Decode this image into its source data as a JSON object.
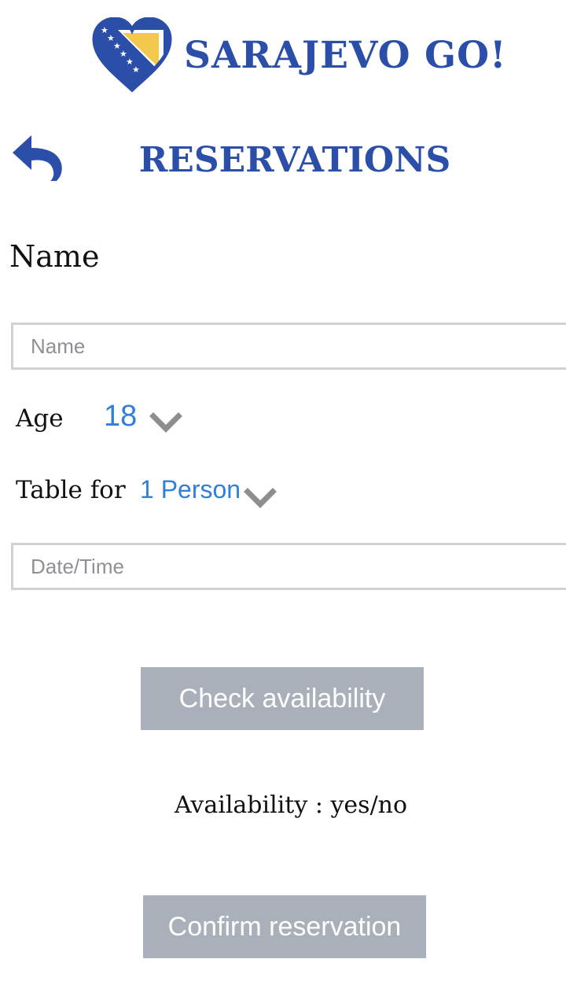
{
  "header": {
    "app_name": "SARAJEVO GO!",
    "logo_icon": "heart-flag-icon"
  },
  "nav": {
    "back_icon": "back-arrow-icon",
    "title": "RESERVATIONS"
  },
  "form": {
    "name_heading": "Name",
    "name_input": {
      "placeholder": "Name",
      "value": ""
    },
    "age": {
      "label": "Age",
      "value": "18",
      "icon": "chevron-down-icon"
    },
    "table_for": {
      "label": "Table for",
      "value": "1 Person",
      "icon": "chevron-down-icon"
    },
    "datetime_input": {
      "placeholder": "Date/Time",
      "value": ""
    }
  },
  "actions": {
    "check_label": "Check availability",
    "availability_text": "Availability : yes/no",
    "confirm_label": "Confirm reservation"
  },
  "colors": {
    "brand_blue": "#2b4fa8",
    "select_blue": "#2f80d6",
    "button_gray": "#a9b0b9",
    "border_gray": "#cfd1d3",
    "chevron_gray": "#8e8e8e"
  }
}
